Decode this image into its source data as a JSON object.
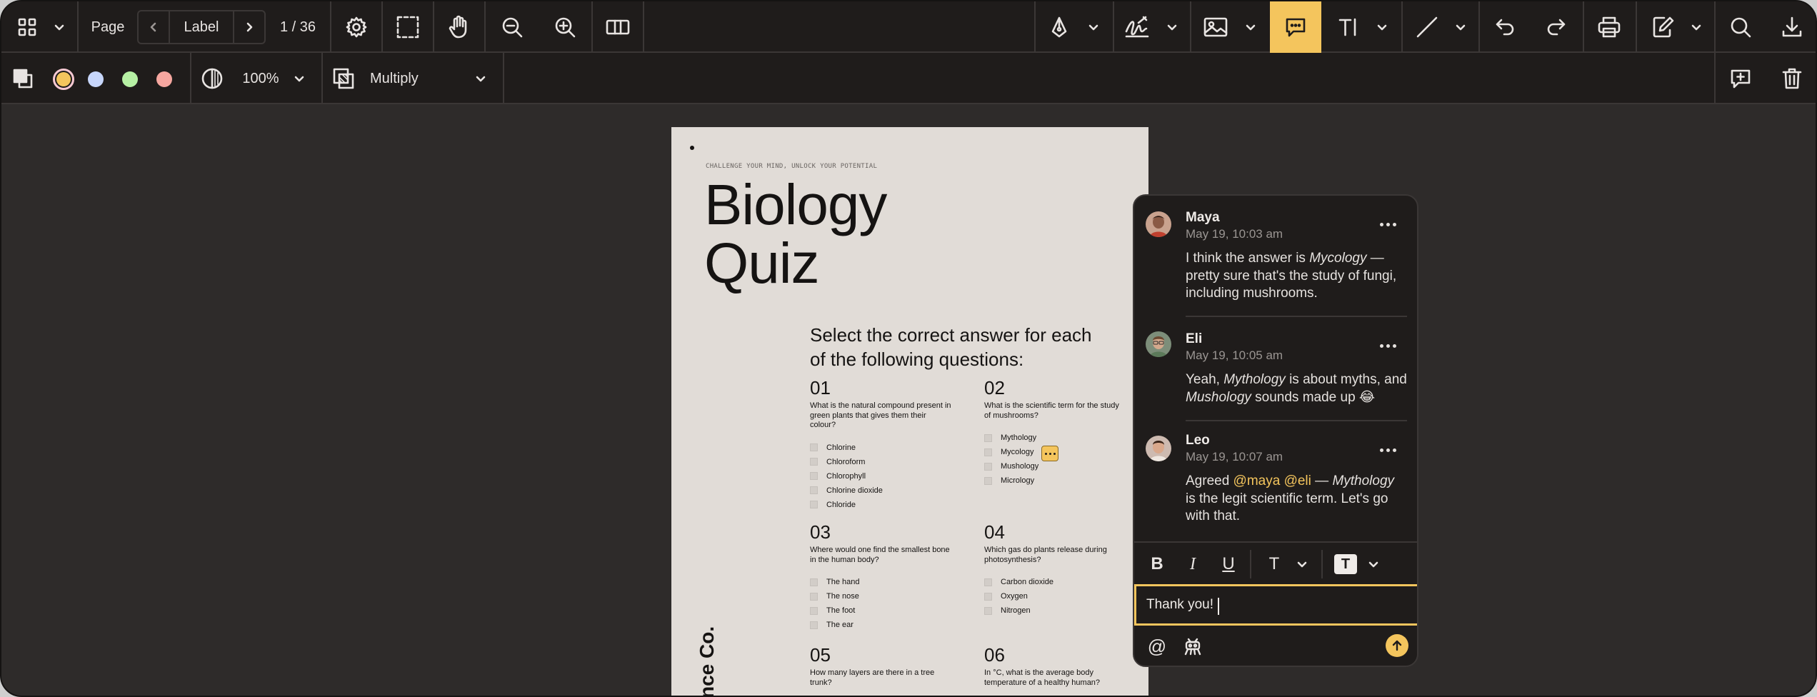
{
  "toolbar": {
    "page_label": "Page",
    "page_field": "Label",
    "page_count": "1 / 36",
    "icons": [
      "grid-icon",
      "chevron-down-icon",
      "chevron-left-icon",
      "chevron-right-icon",
      "gear-icon",
      "marquee-select-icon",
      "hand-icon",
      "zoom-out-icon",
      "zoom-in-icon",
      "columns-icon",
      "pen-icon",
      "signature-icon",
      "image-icon",
      "comment-icon",
      "text-tool-icon",
      "line-icon",
      "undo-icon",
      "redo-icon",
      "print-icon",
      "edit-icon",
      "search-icon",
      "download-icon"
    ]
  },
  "subtoolbar": {
    "zoom": "100%",
    "blend_mode": "Multiply",
    "swatch_colors": [
      "#f4c55d",
      "#c7d6fb",
      "#b6f0a4",
      "#f6a7a0"
    ],
    "accent": "#f4c55d"
  },
  "document": {
    "tagline": "CHALLENGE YOUR MIND, UNLOCK YOUR POTENTIAL",
    "title_line1": "Biology",
    "title_line2": "Quiz",
    "instructions": "Select the correct answer for each of the following questions:",
    "side_text": "nce Co.",
    "questions": [
      {
        "num": "01",
        "text": "What is the natural compound present in green plants that gives them their colour?",
        "options": [
          "Chlorine",
          "Chloroform",
          "Chlorophyll",
          "Chlorine dioxide",
          "Chloride"
        ]
      },
      {
        "num": "02",
        "text": "What is the scientific term for the study of mushrooms?",
        "options": [
          "Mythology",
          "Mycology",
          "Mushology",
          "Micrology"
        ]
      },
      {
        "num": "03",
        "text": "Where would one find the smallest bone in the human body?",
        "options": [
          "The hand",
          "The nose",
          "The foot",
          "The ear"
        ]
      },
      {
        "num": "04",
        "text": "Which gas do plants release during photosynthesis?",
        "options": [
          "Carbon dioxide",
          "Oxygen",
          "Nitrogen"
        ]
      },
      {
        "num": "05",
        "text": "How many layers are there in a tree trunk?",
        "options": []
      },
      {
        "num": "06",
        "text": "In °C, what is the average body temperature of a healthy human?",
        "options": []
      }
    ]
  },
  "comments": [
    {
      "name": "Maya",
      "time": "May 19, 10:03 am",
      "parts": [
        "I think the answer is ",
        "Mycology",
        " — pretty sure that's the study of fungi, including mushrooms."
      ]
    },
    {
      "name": "Eli",
      "time": "May 19, 10:05 am",
      "parts": [
        "Yeah, ",
        "Mythology",
        " is about myths, and ",
        "Mushology",
        " sounds made up 😂"
      ]
    },
    {
      "name": "Leo",
      "time": "May 19, 10:07 am",
      "parts": [
        "Agreed ",
        "@maya",
        " ",
        "@eli",
        " — ",
        "Mythology",
        " is the legit scientific term. Let's go with that."
      ]
    }
  ],
  "composer": {
    "value": "Thank you!",
    "bold": "B",
    "italic": "I",
    "underline": "U",
    "text_style": "T",
    "text_highlight": "T",
    "mention_symbol": "@"
  }
}
